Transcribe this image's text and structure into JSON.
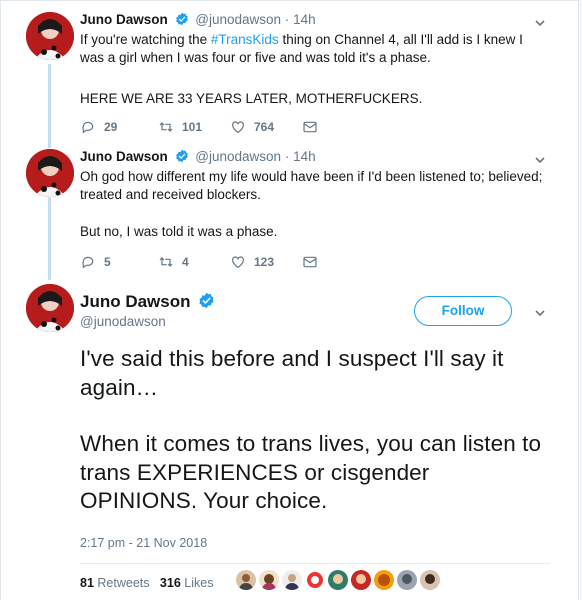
{
  "colors": {
    "link": "#1da1f2",
    "meta": "#657786",
    "text": "#14171a",
    "thread_line": "#c4dff0",
    "like_outline": "#657786"
  },
  "tweets": [
    {
      "name": "Juno Dawson",
      "handle": "@junodawson",
      "time": "· 14h",
      "text_before_tag": "If you're watching the ",
      "hashtag": "#TransKids",
      "text_after_tag": " thing on Channel 4, all I'll add is I knew I was a girl when I was four or five and was told it's a phase.",
      "text2": "HERE WE ARE 33 YEARS LATER, MOTHERFUCKERS.",
      "replies": "29",
      "retweets": "101",
      "likes": "764"
    },
    {
      "name": "Juno Dawson",
      "handle": "@junodawson",
      "time": "· 14h",
      "text1": "Oh god how different my life would have been if I'd been listened to; believed; treated and received blockers.",
      "text2": "But no, I was told it was a phase.",
      "replies": "5",
      "retweets": "4",
      "likes": "123"
    }
  ],
  "main": {
    "name": "Juno Dawson",
    "handle": "@junodawson",
    "follow_label": "Follow",
    "para1": "I've said this before and I suspect I'll say it again…",
    "para2": "When it comes to trans lives, you can listen to trans EXPERIENCES or cisgender OPINIONS. Your choice.",
    "timestamp": "2:17 pm - 21 Nov 2018",
    "retweets_count": "81",
    "retweets_label": "Retweets",
    "likes_count": "316",
    "likes_label": "Likes"
  },
  "icons": [
    "verified-badge-icon",
    "chevron-down-icon",
    "reply-icon",
    "retweet-icon",
    "like-icon",
    "direct-message-icon"
  ]
}
